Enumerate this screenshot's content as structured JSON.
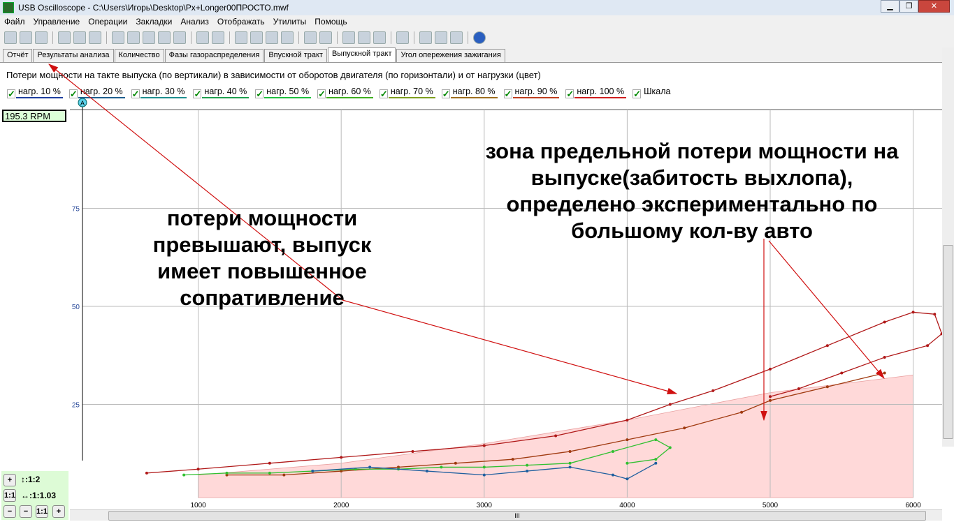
{
  "window": {
    "title": "USB Oscilloscope - C:\\Users\\Игорь\\Desktop\\Px+Longer00ПРОСТО.mwf",
    "minimize": "▁",
    "maximize": "❐",
    "close": "✕"
  },
  "menu": [
    "Файл",
    "Управление",
    "Операции",
    "Закладки",
    "Анализ",
    "Отображать",
    "Утилиты",
    "Помощь"
  ],
  "tabs": [
    "Отчёт",
    "Результаты анализа",
    "Количество",
    "Фазы газораспределения",
    "Впускной тракт",
    "Выпускной тракт",
    "Угол опережения зажигания"
  ],
  "active_tab": "Выпускной тракт",
  "heading": "Потери мощности на такте выпуска (по вертикали) в зависимости от оборотов двигателя (по горизонтали) и от нагрузки (цвет)",
  "legend": [
    {
      "label": "нагр. 10 %",
      "color": "#1f3f9f"
    },
    {
      "label": "нагр. 20 %",
      "color": "#1f5f8f"
    },
    {
      "label": "нагр. 30 %",
      "color": "#1f8f8f"
    },
    {
      "label": "нагр. 40 %",
      "color": "#1fa04f"
    },
    {
      "label": "нагр. 50 %",
      "color": "#1fc03f"
    },
    {
      "label": "нагр. 60 %",
      "color": "#3fb01f"
    },
    {
      "label": "нагр. 70 %",
      "color": "#7f9f1f"
    },
    {
      "label": "нагр. 80 %",
      "color": "#9f6f1f"
    },
    {
      "label": "нагр. 90 %",
      "color": "#bf3f1f"
    },
    {
      "label": "нагр. 100 %",
      "color": "#cf1f1f"
    },
    {
      "label": "Шкала",
      "color": ""
    }
  ],
  "rpm_readout": "195.3 RPM",
  "cursor_label": "A",
  "zoom": {
    "vertical": "↕:1:2",
    "horizontal": "↔:1:1.03",
    "one_to_one": "1:1",
    "plus": "+",
    "minus": "−"
  },
  "scroll_grip": "III",
  "annotations": {
    "left": "потери мощности превышают, выпуск имеет повышенное сопративление",
    "right": "зона предельной потери мощности на выпуске(забитость выхлопа), определено экспериментально по большому кол-ву авто"
  },
  "chart_data": {
    "type": "line",
    "xlim": [
      0,
      6200
    ],
    "ylim": [
      0,
      100
    ],
    "xticks": [
      1000,
      2000,
      3000,
      4000,
      5000,
      6000
    ],
    "yticks": [
      25,
      50,
      75
    ],
    "zone": {
      "color": "#ffd9d9",
      "x": [
        1000,
        2000,
        3000,
        4000,
        5000,
        6000
      ],
      "y": [
        7,
        10,
        15,
        21,
        28,
        32.5
      ]
    },
    "series": [
      {
        "name": "нагр. 100 %",
        "color": "#b01818",
        "x": [
          640,
          1000,
          1500,
          2000,
          2500,
          3000,
          3500,
          4000,
          4300,
          4600,
          5000,
          5400,
          5800,
          6000,
          6150,
          6200,
          6100,
          5800,
          5500,
          5200,
          5000
        ],
        "y": [
          7.5,
          8.5,
          10,
          11.5,
          13,
          14.5,
          17,
          21,
          25,
          28.5,
          34,
          40,
          46,
          48.5,
          48,
          43,
          40,
          37,
          33,
          29,
          27
        ]
      },
      {
        "name": "нагр. 90 %",
        "color": "#a03a10",
        "x": [
          1200,
          1600,
          2000,
          2400,
          2800,
          3200,
          3600,
          4000,
          4400,
          4800,
          5000,
          5400,
          5800
        ],
        "y": [
          7,
          7,
          8,
          9,
          10,
          11,
          13,
          16,
          19,
          23,
          26,
          29.5,
          33
        ]
      },
      {
        "name": "нагр. 60 %",
        "color": "#30c030",
        "x": [
          900,
          1200,
          1500,
          1800,
          2100,
          2400,
          2700,
          3000,
          3300,
          3600,
          3900,
          4200,
          4300,
          4200,
          4000
        ],
        "y": [
          7,
          7.5,
          7.5,
          8,
          8.5,
          8.5,
          9,
          9,
          9.5,
          10,
          13,
          16,
          14,
          11,
          10
        ]
      },
      {
        "name": "нагр. 20 %",
        "color": "#1f5f9f",
        "x": [
          1800,
          2200,
          2600,
          3000,
          3300,
          3600,
          3900,
          4000,
          4200
        ],
        "y": [
          8,
          9,
          8,
          7,
          8,
          9,
          7,
          6,
          10
        ]
      }
    ]
  }
}
